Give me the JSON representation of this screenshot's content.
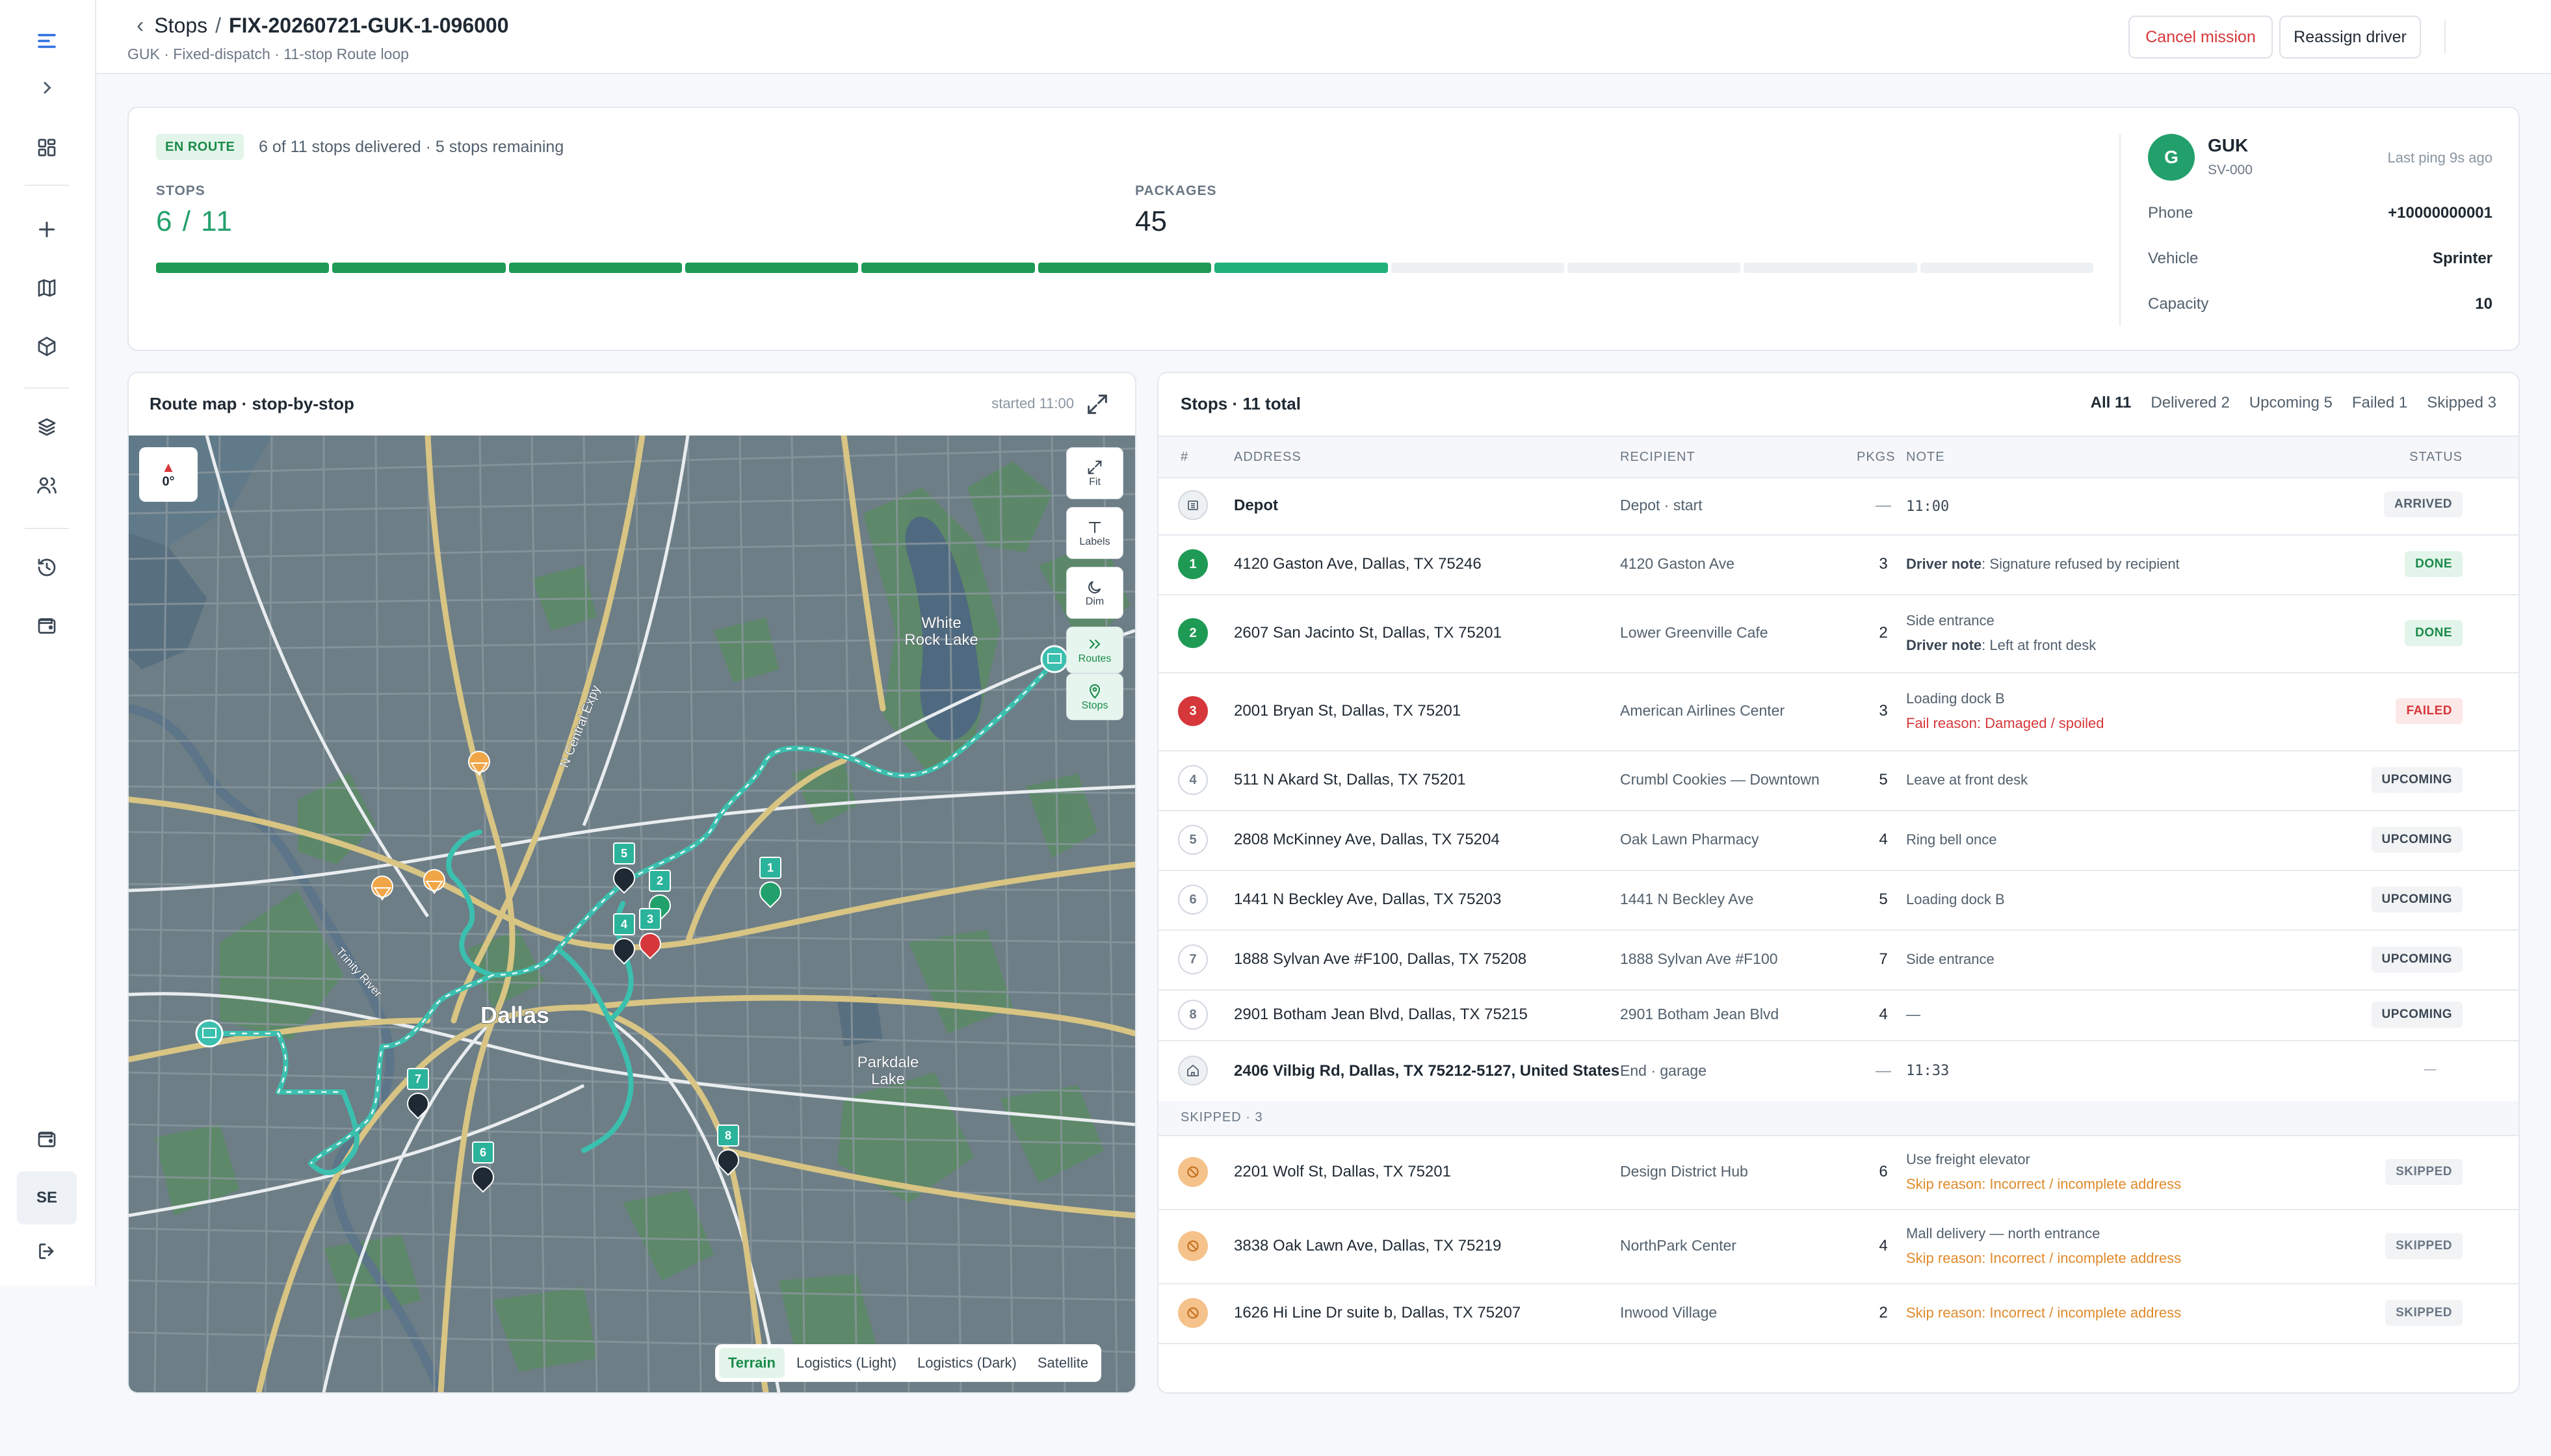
{
  "header": {
    "back_label": "Stops",
    "separator": "/",
    "mission_id": "FIX-20260721-GUK-1-096000",
    "subtitle": "GUK · Fixed-dispatch · 11-stop Route loop",
    "cancel_label": "Cancel mission",
    "reassign_label": "Reassign driver"
  },
  "rail": {
    "user_initials": "SE",
    "icons": [
      "menu-icon",
      "chevron-right-icon",
      "dashboard-icon",
      "plus-icon",
      "map-icon",
      "package-icon",
      "layers-icon",
      "users-icon",
      "history-icon",
      "wallet-icon",
      "wallet-icon",
      "logout-icon"
    ]
  },
  "summary": {
    "status_badge": "EN ROUTE",
    "progress_text": "6 of 11 stops delivered · 5 stops remaining",
    "stops_label": "STOPS",
    "stops_value": "6  /  11",
    "packages_label": "PACKAGES",
    "packages_value": "45",
    "segments_total": 11,
    "segments_done": 6,
    "segments_current": 1
  },
  "driver": {
    "initial": "G",
    "name": "GUK",
    "code": "SV-000",
    "last_ping": "Last ping 9s ago",
    "phone_label": "Phone",
    "phone": "+10000000001",
    "vehicle_label": "Vehicle",
    "vehicle": "Sprinter",
    "capacity_label": "Capacity",
    "capacity": "10"
  },
  "map": {
    "title": "Route map · stop-by-stop",
    "started": "started 11:00",
    "compass_value": "0°",
    "controls": [
      "Fit",
      "Labels",
      "Dim",
      "Routes",
      "Stops"
    ],
    "layers": [
      "Terrain",
      "Logistics (Light)",
      "Logistics (Dark)",
      "Satellite"
    ],
    "selected_layer": "Terrain",
    "place_labels": {
      "dallas": "Dallas",
      "white_rock_1": "White",
      "white_rock_2": "Rock Lake",
      "parkdale_1": "Parkdale",
      "parkdale_2": "Lake",
      "expressway": "N Central Expy",
      "river": "Trinity River"
    },
    "pins": [
      "1",
      "2",
      "3",
      "4",
      "5",
      "6",
      "7",
      "8"
    ]
  },
  "stops": {
    "title": "Stops · 11 total",
    "tabs": [
      "All 11",
      "Delivered 2",
      "Upcoming 5",
      "Failed 1",
      "Skipped 3"
    ],
    "columns": [
      "#",
      "ADDRESS",
      "RECIPIENT",
      "PKGS",
      "NOTE",
      "STATUS"
    ],
    "depot": {
      "address": "Depot",
      "recipient": "Depot · start",
      "pkgs": "—",
      "time": "11:00",
      "status": "ARRIVED"
    },
    "rows": [
      {
        "n": "1",
        "address": "4120 Gaston Ave, Dallas, TX 75246",
        "recipient": "4120 Gaston Ave",
        "pkgs": "3",
        "note1": "",
        "note_key": "Driver note",
        "note_val": ": Signature refused by recipient",
        "status": "DONE"
      },
      {
        "n": "2",
        "address": "2607 San Jacinto St, Dallas, TX 75201",
        "recipient": "Lower Greenville Cafe",
        "pkgs": "2",
        "note1": "Side entrance",
        "note_key": "Driver note",
        "note_val": ": Left at front desk",
        "status": "DONE"
      },
      {
        "n": "3",
        "address": "2001 Bryan St, Dallas, TX 75201",
        "recipient": "American Airlines Center",
        "pkgs": "3",
        "note1": "Loading dock B",
        "note_key": "Fail reason",
        "note_val": ": Damaged / spoiled",
        "status": "FAILED"
      },
      {
        "n": "4",
        "address": "511 N Akard St, Dallas, TX 75201",
        "recipient": "Crumbl Cookies — Downtown",
        "pkgs": "5",
        "note1": "Leave at front desk",
        "status": "UPCOMING"
      },
      {
        "n": "5",
        "address": "2808 McKinney Ave, Dallas, TX 75204",
        "recipient": "Oak Lawn Pharmacy",
        "pkgs": "4",
        "note1": "Ring bell once",
        "status": "UPCOMING"
      },
      {
        "n": "6",
        "address": "1441 N Beckley Ave, Dallas, TX 75203",
        "recipient": "1441 N Beckley Ave",
        "pkgs": "5",
        "note1": "Loading dock B",
        "status": "UPCOMING"
      },
      {
        "n": "7",
        "address": "1888 Sylvan Ave #F100, Dallas, TX 75208",
        "recipient": "1888 Sylvan Ave #F100",
        "pkgs": "7",
        "note1": "Side entrance",
        "status": "UPCOMING"
      },
      {
        "n": "8",
        "address": "2901 Botham Jean Blvd, Dallas, TX 75215",
        "recipient": "2901 Botham Jean Blvd",
        "pkgs": "4",
        "note1": "—",
        "status": "UPCOMING"
      }
    ],
    "end": {
      "address": "2406 Vilbig Rd, Dallas, TX 75212-5127, United States",
      "recipient": "End · garage",
      "pkgs": "—",
      "time": "11:33",
      "status": "—"
    },
    "skipped_header": "SKIPPED · 3",
    "skipped": [
      {
        "address": "2201 Wolf St, Dallas, TX 75201",
        "recipient": "Design District Hub",
        "pkgs": "6",
        "note1": "Use freight elevator",
        "skip_key": "Skip reason",
        "skip_val": ": Incorrect / incomplete address",
        "status": "SKIPPED"
      },
      {
        "address": "3838 Oak Lawn Ave, Dallas, TX 75219",
        "recipient": "NorthPark Center",
        "pkgs": "4",
        "note1": "Mall delivery — north entrance",
        "skip_key": "Skip reason",
        "skip_val": ": Incorrect / incomplete address",
        "status": "SKIPPED"
      },
      {
        "address": "1626 Hi Line Dr suite b, Dallas, TX 75207",
        "recipient": "Inwood Village",
        "pkgs": "2",
        "note1": "",
        "skip_key": "Skip reason",
        "skip_val": ": Incorrect / incomplete address",
        "status": "SKIPPED"
      }
    ]
  },
  "colors": {
    "accent": "#22a06b",
    "done": "#1f9a55",
    "failed": "#d6373a",
    "skipped": "#e08a2b",
    "route": "#3bbfae"
  }
}
